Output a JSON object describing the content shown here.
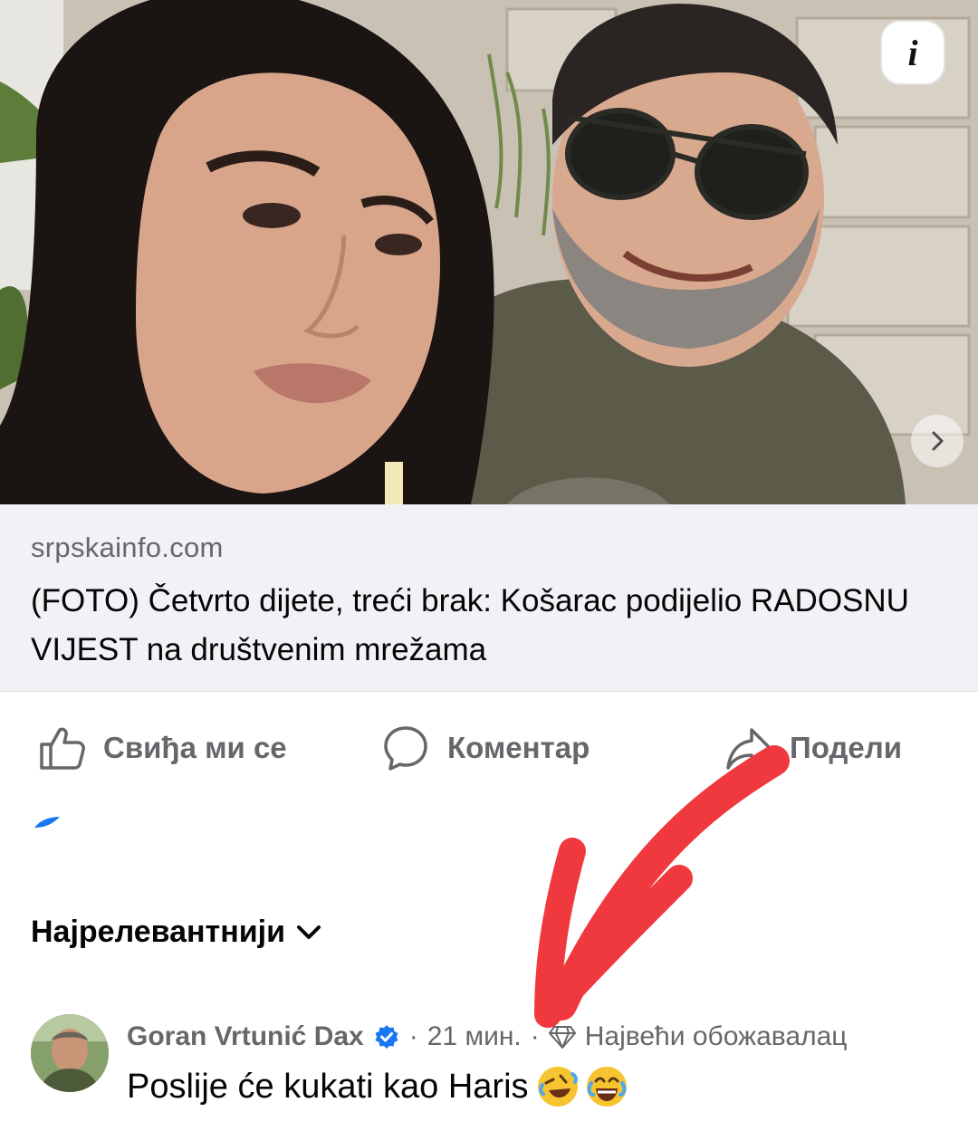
{
  "post": {
    "image_alt": "selfie-photo",
    "info_icon_glyph": "i",
    "next_icon": "chevron-right-icon"
  },
  "link_preview": {
    "domain": "srpskainfo.com",
    "title": "(FOTO) Četvrto dijete, treći brak: Košarac podijelio RADOSNU VIJEST na društvenim mrežama"
  },
  "actions": {
    "like_label": "Свиђа ми се",
    "comment_label": "Коментар",
    "share_label": "Подели"
  },
  "comments_sort": {
    "label": "Најрелевантнији"
  },
  "comment": {
    "author": "Goran Vrtunić Dax",
    "verified": true,
    "separator": "·",
    "time": "21 мин.",
    "badge_separator": "·",
    "badge": "Највећи обожавалац",
    "text": "Poslije će kukati kao Haris",
    "emojis": [
      "rolling-on-floor-laughing-emoji",
      "face-with-tears-of-joy-emoji"
    ]
  },
  "colors": {
    "annotation_arrow": "#f0393e",
    "verified_badge": "#1877f2",
    "secondary_text": "#65676b",
    "link_card_bg": "#f0f2f5"
  }
}
